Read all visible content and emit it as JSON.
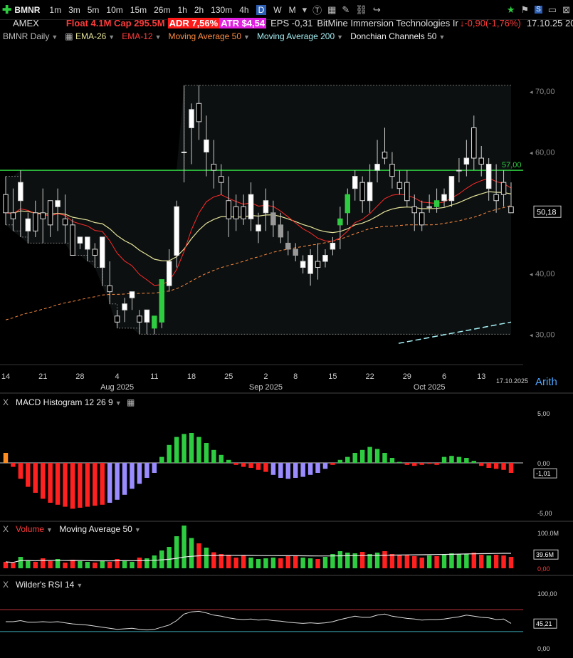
{
  "toolbar": {
    "symbol": "BMNR",
    "timeframes": [
      "1m",
      "3m",
      "5m",
      "10m",
      "15m",
      "26m",
      "1h",
      "2h",
      "130m",
      "4h",
      "D",
      "W",
      "M"
    ],
    "active_timeframe": "D"
  },
  "info": {
    "exchange": "AMEX",
    "float": "Float 4.1M Cap 295.5M",
    "adr_label": "ADR 7,56%",
    "atr_label": "ATR $4,54",
    "eps": "EPS -0,31",
    "company": "BitMine Immersion Technologies Ir",
    "change": "-0,90(-1,76%)",
    "datetime": "17.10.25 20:00:00"
  },
  "legend": {
    "chart_name": "BMNR Daily",
    "ema26": "EMA-26",
    "ema12": "EMA-12",
    "ma50": "Moving Average 50",
    "ma200": "Moving Average 200",
    "donchian": "Donchian Channels 50"
  },
  "colors": {
    "up": "#2ecc40",
    "down": "#ff2020",
    "ema26": "#e5e39a",
    "ema12": "#ff2a2a",
    "ma50": "#ff8c42",
    "ma200": "#a6f0f5",
    "hline": "#2ecc40"
  },
  "axis": {
    "price_ticks": [
      "70,00",
      "60,00",
      "40,00",
      "30,00"
    ],
    "last_price": "50,18",
    "hline_label": "57,00",
    "date_ticks": [
      "14",
      "21",
      "28",
      "4",
      "11",
      "18",
      "25",
      "2",
      "8",
      "15",
      "22",
      "29",
      "6",
      "13"
    ],
    "month_labels": [
      "Aug 2025",
      "Sep 2025",
      "Oct 2025"
    ],
    "last_date": "17.10.2025",
    "scale": "Arith"
  },
  "macd": {
    "label": "MACD Histogram 12 26 9",
    "ticks": [
      "5,00",
      "0,00",
      "-5,00"
    ],
    "last": "-1,01"
  },
  "volume": {
    "label": "Volume",
    "ma_label": "Moving Average 50",
    "ticks": [
      "100.0M",
      "0,00"
    ],
    "last": "39.6M"
  },
  "rsi": {
    "label": "Wilder's RSI 14",
    "ticks": [
      "100,00",
      "0,00"
    ],
    "last": "45,21"
  },
  "chart_data": {
    "type": "candlestick",
    "title": "BMNR Daily",
    "ylim": [
      25,
      78
    ],
    "hline": 57,
    "dates": [
      "07-14",
      "07-15",
      "07-16",
      "07-17",
      "07-18",
      "07-21",
      "07-22",
      "07-23",
      "07-24",
      "07-25",
      "07-28",
      "07-29",
      "07-30",
      "07-31",
      "08-01",
      "08-04",
      "08-05",
      "08-06",
      "08-07",
      "08-08",
      "08-11",
      "08-12",
      "08-13",
      "08-14",
      "08-15",
      "08-18",
      "08-19",
      "08-20",
      "08-21",
      "08-22",
      "08-25",
      "08-26",
      "08-27",
      "08-28",
      "08-29",
      "09-02",
      "09-03",
      "09-04",
      "09-05",
      "09-08",
      "09-09",
      "09-10",
      "09-11",
      "09-12",
      "09-15",
      "09-16",
      "09-17",
      "09-18",
      "09-19",
      "09-22",
      "09-23",
      "09-24",
      "09-25",
      "09-26",
      "09-29",
      "09-30",
      "10-01",
      "10-02",
      "10-03",
      "10-06",
      "10-07",
      "10-08",
      "10-09",
      "10-10",
      "10-13",
      "10-14",
      "10-15",
      "10-16",
      "10-17"
    ],
    "ohlc": [
      [
        53,
        56,
        48,
        50
      ],
      [
        50,
        54,
        47,
        49
      ],
      [
        52,
        57,
        46,
        55
      ],
      [
        47,
        50,
        45,
        49
      ],
      [
        50,
        52,
        46,
        47
      ],
      [
        50,
        54,
        45,
        49
      ],
      [
        52,
        52,
        46,
        48
      ],
      [
        51,
        54,
        47,
        52
      ],
      [
        49,
        53,
        45,
        48
      ],
      [
        48,
        49,
        43,
        43
      ],
      [
        45,
        46,
        44,
        46
      ],
      [
        44,
        45,
        42,
        46
      ],
      [
        44,
        45,
        41,
        43
      ],
      [
        41,
        46,
        38,
        46
      ],
      [
        38,
        42,
        35,
        37
      ],
      [
        33,
        34,
        31,
        32
      ],
      [
        34,
        36,
        32,
        35
      ],
      [
        36,
        37,
        34,
        37
      ],
      [
        33,
        34,
        30,
        32
      ],
      [
        32,
        34,
        30,
        34
      ],
      [
        31,
        33,
        30,
        33
      ],
      [
        32,
        39,
        31,
        39
      ],
      [
        38,
        44,
        37,
        42
      ],
      [
        43,
        52,
        41,
        51
      ],
      [
        60,
        71,
        55,
        60
      ],
      [
        64,
        68,
        58,
        67
      ],
      [
        68,
        71,
        62,
        65
      ],
      [
        60,
        66,
        56,
        62
      ],
      [
        58,
        62,
        54,
        57
      ],
      [
        56,
        58,
        53,
        55
      ],
      [
        52,
        56,
        46,
        49
      ],
      [
        51,
        53,
        47,
        49
      ],
      [
        51,
        53,
        48,
        49
      ],
      [
        49,
        55,
        47,
        53
      ],
      [
        47,
        50,
        45,
        48
      ],
      [
        50,
        54,
        47,
        52
      ],
      [
        48,
        52,
        46,
        50
      ],
      [
        48,
        50,
        45,
        46
      ],
      [
        45,
        47,
        43,
        44
      ],
      [
        44,
        45,
        42,
        43
      ],
      [
        41,
        43,
        40,
        42
      ],
      [
        40,
        44,
        38,
        43
      ],
      [
        42,
        45,
        39,
        41
      ],
      [
        42,
        44,
        41,
        43
      ],
      [
        44,
        46,
        43,
        45
      ],
      [
        48,
        51,
        44,
        49
      ],
      [
        50,
        54,
        48,
        53
      ],
      [
        54,
        57,
        52,
        56
      ],
      [
        55,
        56,
        50,
        52
      ],
      [
        52,
        58,
        50,
        55
      ],
      [
        57,
        62,
        55,
        58
      ],
      [
        60,
        64,
        58,
        59
      ],
      [
        58,
        60,
        54,
        56
      ],
      [
        55,
        57,
        53,
        54
      ],
      [
        55,
        57,
        51,
        52
      ],
      [
        51,
        53,
        47,
        50
      ],
      [
        50,
        52,
        47,
        48
      ],
      [
        51,
        53,
        50,
        51
      ],
      [
        52,
        54,
        50,
        51
      ],
      [
        52,
        54,
        51,
        53
      ],
      [
        52,
        56,
        51,
        56
      ],
      [
        57,
        59,
        55,
        57
      ],
      [
        58,
        62,
        56,
        59
      ],
      [
        64,
        66,
        57,
        59
      ],
      [
        59,
        61,
        56,
        58
      ],
      [
        54,
        59,
        52,
        58
      ],
      [
        53,
        58,
        50,
        52
      ],
      [
        55,
        57,
        51,
        53
      ],
      [
        51,
        55,
        50,
        50
      ]
    ],
    "macd_hist": [
      1.0,
      -0.4,
      -1.6,
      -2.4,
      -3.0,
      -3.6,
      -4.0,
      -4.2,
      -4.4,
      -4.6,
      -4.5,
      -4.4,
      -4.3,
      -4.2,
      -4.0,
      -3.7,
      -3.2,
      -2.6,
      -2.1,
      -1.5,
      -1.0,
      0.6,
      1.8,
      2.6,
      2.9,
      3.0,
      2.6,
      2.0,
      1.3,
      0.8,
      0.3,
      -0.2,
      -0.4,
      -0.5,
      -0.7,
      -0.9,
      -1.2,
      -1.5,
      -1.6,
      -1.5,
      -1.4,
      -1.2,
      -1.0,
      -0.6,
      -0.2,
      0.3,
      0.6,
      1.0,
      1.3,
      1.6,
      1.4,
      1.0,
      0.5,
      0.1,
      -0.2,
      -0.3,
      -0.2,
      -0.1,
      -0.2,
      0.6,
      0.7,
      0.6,
      0.5,
      0.2,
      -0.3,
      -0.5,
      -0.6,
      -0.7,
      -1.0
    ],
    "volume_m": [
      18,
      15,
      32,
      22,
      18,
      28,
      20,
      26,
      16,
      24,
      20,
      18,
      16,
      22,
      18,
      26,
      20,
      18,
      30,
      28,
      36,
      50,
      60,
      90,
      120,
      85,
      70,
      58,
      45,
      40,
      38,
      30,
      36,
      30,
      26,
      28,
      30,
      28,
      36,
      34,
      30,
      28,
      26,
      32,
      40,
      48,
      44,
      42,
      46,
      40,
      44,
      48,
      40,
      36,
      38,
      34,
      30,
      36,
      34,
      40,
      42,
      40,
      40,
      44,
      38,
      36,
      38,
      36,
      32
    ],
    "volume_ma50": 39.6,
    "rsi": [
      48,
      48,
      50,
      47,
      47,
      48,
      47,
      48,
      46,
      44,
      43,
      42,
      40,
      38,
      36,
      34,
      35,
      36,
      34,
      33,
      34,
      38,
      42,
      50,
      62,
      66,
      67,
      64,
      60,
      58,
      55,
      53,
      52,
      53,
      51,
      52,
      50,
      49,
      47,
      46,
      45,
      46,
      45,
      46,
      48,
      52,
      55,
      58,
      56,
      56,
      60,
      62,
      58,
      56,
      54,
      53,
      51,
      52,
      52,
      53,
      55,
      57,
      60,
      58,
      56,
      55,
      52,
      53,
      45
    ],
    "rsi_levels": [
      70,
      30
    ]
  }
}
